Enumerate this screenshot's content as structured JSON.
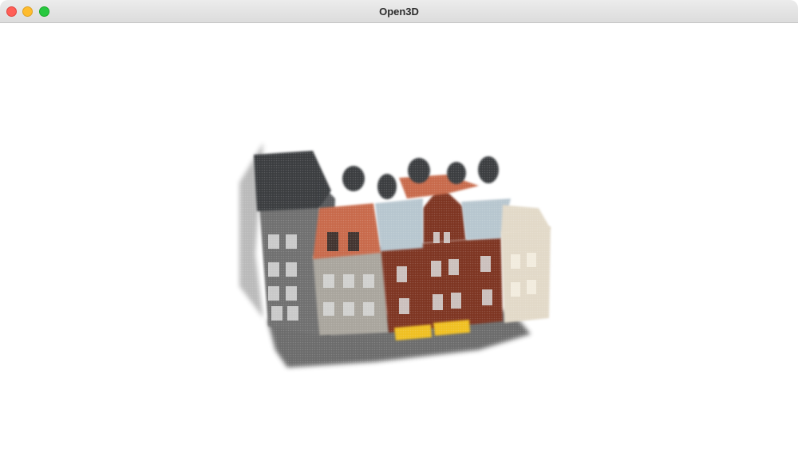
{
  "window": {
    "title": "Open3D"
  },
  "titlebar": {
    "buttons": {
      "close": {
        "icon": "close-icon",
        "color": "#ff5f57"
      },
      "minimize": {
        "icon": "minimize-icon",
        "color": "#febc2e"
      },
      "zoom": {
        "icon": "zoom-icon",
        "color": "#28c840"
      }
    }
  },
  "viewport": {
    "background": "#ffffff",
    "content": "point-cloud-scene",
    "colors": {
      "gray_building": "#6f6f6f",
      "gray_building_dark": "#3a3c40",
      "light_building": "#a9a59d",
      "roof_terracotta": "#c86b4c",
      "red_building": "#7e3423",
      "roof_blue": "#b7c6cf",
      "cream_building": "#e2d9c8",
      "awning_yellow": "#f0c020",
      "ground_shadow": "#3a3a3a"
    }
  }
}
